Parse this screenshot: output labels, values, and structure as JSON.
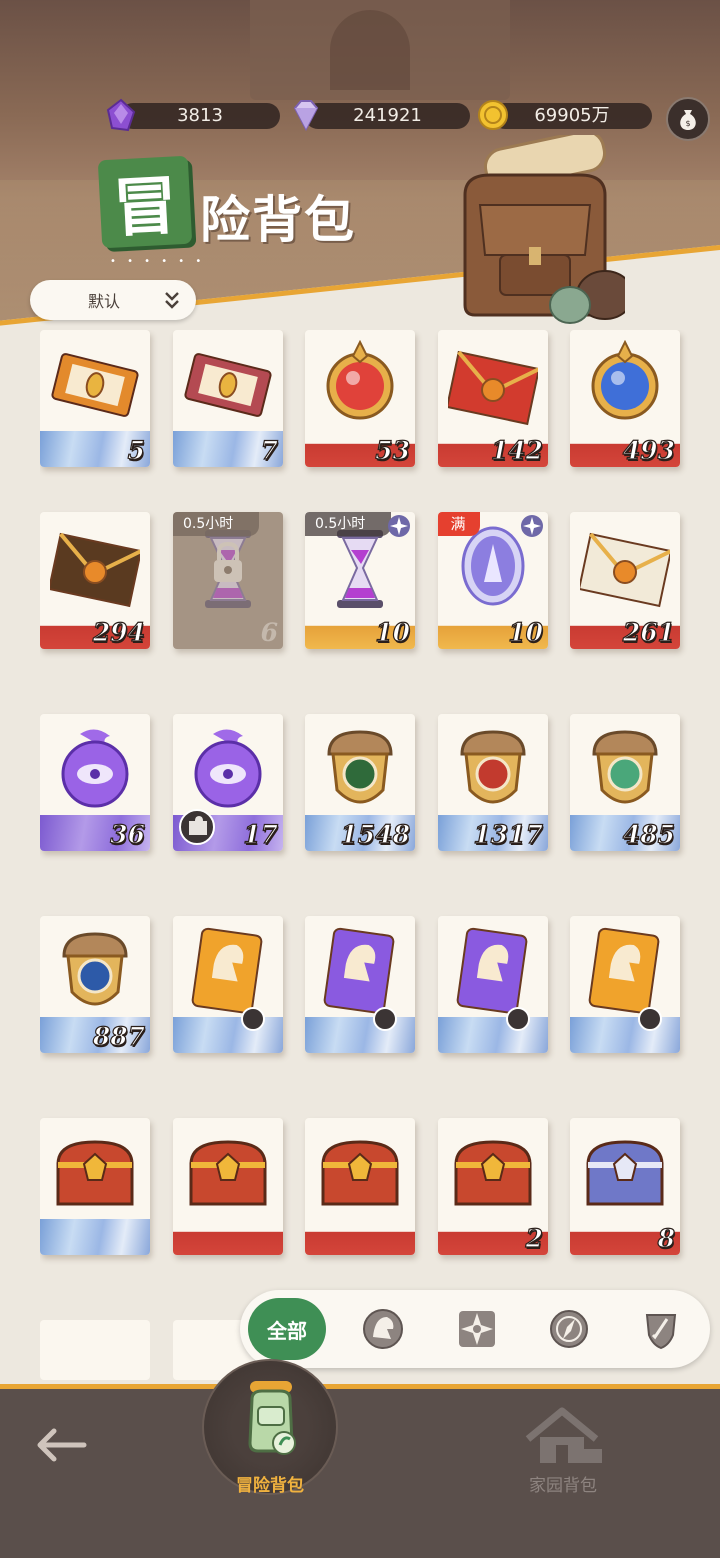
{
  "currencies": [
    {
      "name": "purple-crystal",
      "value": "3813"
    },
    {
      "name": "diamond",
      "value": "241921"
    },
    {
      "name": "gold-coin",
      "value": "69905万"
    }
  ],
  "title": {
    "badge": "冒",
    "text": "险背包"
  },
  "sort": {
    "label": "默认"
  },
  "rows": [
    [
      {
        "item": "orange-ticket",
        "qty": "5",
        "bottom": "blue"
      },
      {
        "item": "red-ticket",
        "qty": "7",
        "bottom": "blue"
      },
      {
        "item": "red-gem-crest",
        "qty": "53",
        "bottom": "red"
      },
      {
        "item": "gold-envelope",
        "qty": "142",
        "bottom": "red"
      },
      {
        "item": "blue-orb-crest",
        "qty": "493",
        "bottom": "red"
      }
    ],
    [
      {
        "item": "brown-envelope",
        "qty": "294",
        "bottom": "red"
      },
      {
        "item": "locked-hourglass",
        "qty": "6",
        "timer": "0.5小时",
        "locked": true
      },
      {
        "item": "purple-hourglass",
        "qty": "10",
        "timer": "0.5小时",
        "bottom": "gold"
      },
      {
        "item": "spirit-mirror",
        "qty": "10",
        "badge": "满",
        "bottom": "gold"
      },
      {
        "item": "white-envelope",
        "qty": "261",
        "bottom": "red"
      }
    ],
    [
      {
        "item": "purple-eye-orb",
        "qty": "36",
        "bottom": "purple"
      },
      {
        "item": "purple-trident-orb",
        "qty": "17",
        "bottom": "purple"
      },
      {
        "item": "acorn-green-eye",
        "qty": "1548",
        "bottom": "blue"
      },
      {
        "item": "acorn-red-pin",
        "qty": "1317",
        "bottom": "blue"
      },
      {
        "item": "acorn-leaf",
        "qty": "485",
        "bottom": "blue"
      }
    ],
    [
      {
        "item": "acorn-star",
        "qty": "887",
        "bottom": "blue"
      },
      {
        "item": "gold-helmet-card",
        "qty": "",
        "bottom": "blue"
      },
      {
        "item": "purple-helmet-card",
        "qty": "",
        "bottom": "blue"
      },
      {
        "item": "purple-helmet-card-2",
        "qty": "",
        "bottom": "blue"
      },
      {
        "item": "gold-helmet-card-2",
        "qty": "",
        "bottom": "blue"
      }
    ],
    [
      {
        "item": "red-chest",
        "qty": "",
        "bottom": "blue"
      },
      {
        "item": "red-chest-2",
        "qty": "",
        "bottom": "red"
      },
      {
        "item": "red-chest-3",
        "qty": "",
        "bottom": "red"
      },
      {
        "item": "red-chest-4",
        "qty": "2",
        "bottom": "red"
      },
      {
        "item": "blue-chest",
        "qty": "8",
        "bottom": "red"
      }
    ]
  ],
  "filters": {
    "all_label": "全部",
    "tabs": [
      "warrior-helmet-icon",
      "compass-star-icon",
      "compass-icon",
      "shield-icon"
    ]
  },
  "nav": {
    "adventure_label": "冒险背包",
    "home_label": "家园背包"
  },
  "colors": {
    "accent": "#e8a534",
    "green": "#3f8f55",
    "nav_bg": "#5a4f4b",
    "full_badge": "#e5402f"
  }
}
